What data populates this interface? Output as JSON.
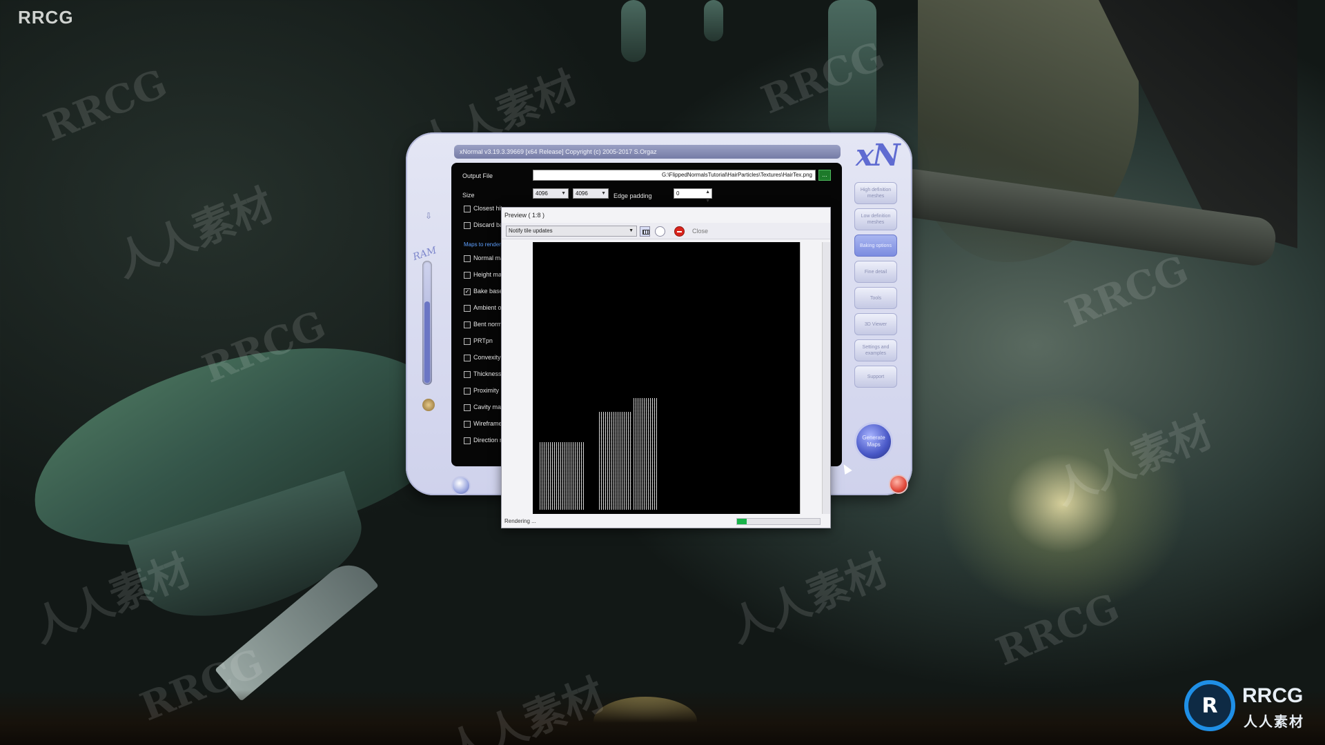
{
  "corner_logo": "RRCG",
  "watermarks": {
    "latin": "RRCG",
    "cjk": "人人素材"
  },
  "xnormal": {
    "title": "xNormal v3.19.3.39669 [x64 Release] Copyright (c) 2005-2017 S.Orgaz",
    "logo": "xN",
    "output_file_label": "Output File",
    "output_file_value": "G:\\FlippedNormalsTutorial\\HairParticles\\Textures\\HairTex.png",
    "browse_label": "...",
    "size_label": "Size",
    "size_width": "4096",
    "size_height": "4096",
    "edge_padding_label": "Edge padding",
    "edge_padding_value": "0",
    "closest_hit_label": "Closest hit if",
    "discard_back_label": "Discard back",
    "maps_title": "Maps to render",
    "maps": [
      {
        "label": "Normal map",
        "checked": false
      },
      {
        "label": "Height map",
        "checked": false
      },
      {
        "label": "Bake base texture",
        "checked": true
      },
      {
        "label": "Ambient occlusion",
        "checked": false
      },
      {
        "label": "Bent normal",
        "checked": false
      },
      {
        "label": "PRTpn",
        "checked": false
      },
      {
        "label": "Convexity map",
        "checked": false
      },
      {
        "label": "Thickness",
        "checked": false
      },
      {
        "label": "Proximity map",
        "checked": false
      },
      {
        "label": "Cavity map",
        "checked": false
      },
      {
        "label": "Wireframe",
        "checked": false
      },
      {
        "label": "Direction map",
        "checked": false
      }
    ],
    "ram_label": "RAM",
    "ram_level_percent": 68,
    "nav": [
      {
        "label": "High definition meshes",
        "active": false
      },
      {
        "label": "Low definition meshes",
        "active": false
      },
      {
        "label": "Baking options",
        "active": true
      },
      {
        "label": "Fine detail",
        "active": false
      },
      {
        "label": "Tools",
        "active": false
      },
      {
        "label": "3D Viewer",
        "active": false
      },
      {
        "label": "Settings and examples",
        "active": false
      },
      {
        "label": "Support",
        "active": false
      }
    ],
    "generate_label": "Generate Maps"
  },
  "preview": {
    "title": "Preview ( 1:8 )",
    "notify_option": "Notify tile updates",
    "close_label": "Close",
    "status": "Rendering ...",
    "progress_fraction": 0.12,
    "colors": {
      "progress": "#19b34a",
      "stop": "#d9241c"
    }
  },
  "brand_logo": {
    "mark": "R",
    "top": "RRCG",
    "bottom": "人人素材"
  }
}
